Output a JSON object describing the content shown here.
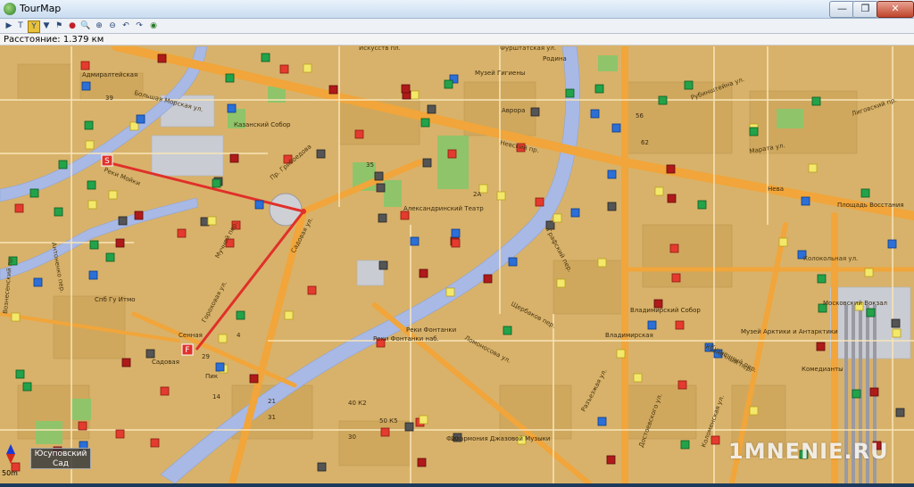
{
  "window": {
    "title": "TourMap",
    "btn_minimize": "—",
    "btn_maximize": "❐",
    "btn_close": "✕"
  },
  "toolbar": {
    "icons": [
      "arrow-icon",
      "text-icon",
      "route-icon",
      "filter-icon",
      "stop-icon",
      "zoom-icon",
      "zoom-in-icon",
      "zoom-out-icon",
      "undo-icon",
      "redo-icon",
      "globe-icon"
    ]
  },
  "status": {
    "distance": "Расстояние: 1.379 км"
  },
  "route": {
    "start_marker": "S",
    "finish_marker": "F",
    "color": "#e0302a"
  },
  "map": {
    "landmarks": [
      "Адмиралтейская",
      "Казанский Собор",
      "Музей Гигиены",
      "Аврора",
      "Родина",
      "Александринский Театр",
      "Нева",
      "Площадь Восстания",
      "Владимирский Собор",
      "Владимирская",
      "Музей Арктики и Антарктики",
      "Московский Вокзал",
      "Комедианты",
      "Филармония Джазовой Музыки",
      "Садовая",
      "Пик",
      "Спб Гу Итмо",
      "Реки Фонтанки наб.",
      "Реки Фонтанки",
      "Сенная"
    ],
    "streets": [
      "Садовая ул.",
      "Гороховая ул.",
      "Мучной пер.",
      "Щербаков пер.",
      "Графский пер.",
      "Ломоносова ул.",
      "Разъезжая ул.",
      "Кузнечный пер.",
      "Лиговский пр.",
      "Коломенская ул.",
      "Невский пр.",
      "Реки Мойки",
      "Антоненко пер.",
      "Вознесенский пр.",
      "Большая Морская ул.",
      "Пр. Грибоедова",
      "Искусств пл.",
      "Фурштатская ул.",
      "Достоевского ул.",
      "Марата ул.",
      "Рубинштейна ул.",
      "Кузнечный пер.",
      "Колокольная ул."
    ],
    "house_numbers": [
      "39",
      "35",
      "2А",
      "56",
      "62",
      "29",
      "40 К2",
      "50 К5",
      "21",
      "31",
      "14",
      "4",
      "30",
      "20"
    ]
  },
  "scale": "50m",
  "poi_tip": {
    "line1": "Юсуповский",
    "line2": "Сад"
  },
  "watermark": "1MNENIE.RU"
}
